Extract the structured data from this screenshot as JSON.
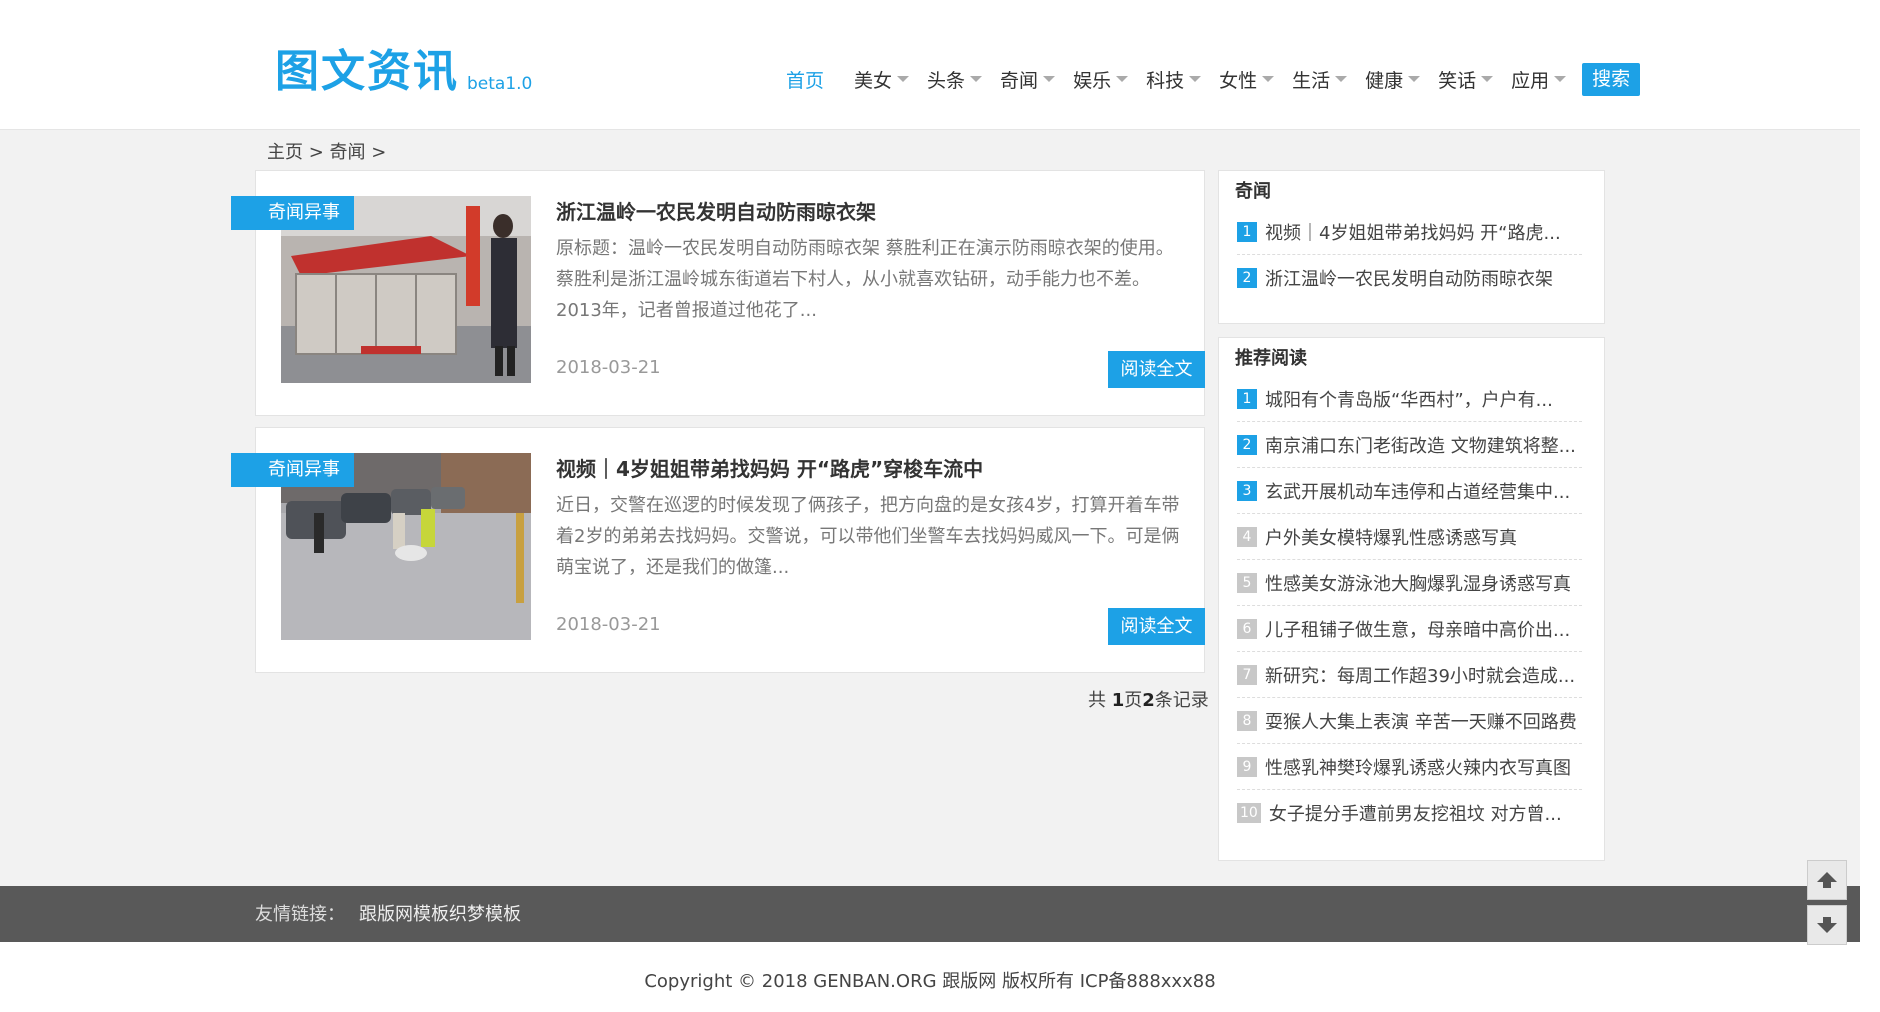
{
  "header": {
    "logo_text": "图文资讯",
    "logo_beta": "beta1.0",
    "nav": [
      {
        "label": "首页",
        "active": true,
        "dropdown": false
      },
      {
        "label": "美女",
        "active": false,
        "dropdown": true
      },
      {
        "label": "头条",
        "active": false,
        "dropdown": true
      },
      {
        "label": "奇闻",
        "active": false,
        "dropdown": true
      },
      {
        "label": "娱乐",
        "active": false,
        "dropdown": true
      },
      {
        "label": "科技",
        "active": false,
        "dropdown": true
      },
      {
        "label": "女性",
        "active": false,
        "dropdown": true
      },
      {
        "label": "生活",
        "active": false,
        "dropdown": true
      },
      {
        "label": "健康",
        "active": false,
        "dropdown": true
      },
      {
        "label": "笑话",
        "active": false,
        "dropdown": true
      },
      {
        "label": "应用",
        "active": false,
        "dropdown": true
      }
    ],
    "search_label": "搜索"
  },
  "breadcrumb": "主页 > 奇闻 >",
  "articles": [
    {
      "tag": "奇闻异事",
      "title": "浙江温岭一农民发明自动防雨晾衣架",
      "desc": "原标题：温岭一农民发明自动防雨晾衣架 蔡胜利正在演示防雨晾衣架的使用。蔡胜利是浙江温岭城东街道岩下村人，从小就喜欢钻研，动手能力也不差。2013年，记者曾报道过他花了...",
      "date": "2018-03-21",
      "read_label": "阅读全文"
    },
    {
      "tag": "奇闻异事",
      "title": "视频｜4岁姐姐带弟找妈妈 开“路虎”穿梭车流中",
      "desc": "近日，交警在巡逻的时候发现了俩孩子，把方向盘的是女孩4岁，打算开着车带着2岁的弟弟去找妈妈。交警说，可以带他们坐警车去找妈妈威风一下。可是俩萌宝说了，还是我们的做篷...",
      "date": "2018-03-21",
      "read_label": "阅读全文"
    }
  ],
  "pagination": {
    "prefix": "共 ",
    "pages": "1",
    "mid": "页",
    "count": "2",
    "suffix": "条记录"
  },
  "sidebar": {
    "box1": {
      "title": "奇闻",
      "items": [
        {
          "num": "1",
          "text": "视频｜4岁姐姐带弟找妈妈 开“路虎..."
        },
        {
          "num": "2",
          "text": "浙江温岭一农民发明自动防雨晾衣架"
        }
      ]
    },
    "box2": {
      "title": "推荐阅读",
      "items": [
        {
          "num": "1",
          "text": "城阳有个青岛版“华西村”，户户有..."
        },
        {
          "num": "2",
          "text": "南京浦口东门老街改造 文物建筑将整..."
        },
        {
          "num": "3",
          "text": "玄武开展机动车违停和占道经营集中..."
        },
        {
          "num": "4",
          "text": "户外美女模特爆乳性感诱惑写真"
        },
        {
          "num": "5",
          "text": "性感美女游泳池大胸爆乳湿身诱惑写真"
        },
        {
          "num": "6",
          "text": "儿子租铺子做生意，母亲暗中高价出..."
        },
        {
          "num": "7",
          "text": "新研究：每周工作超39小时就会造成..."
        },
        {
          "num": "8",
          "text": "耍猴人大集上表演 辛苦一天赚不回路费"
        },
        {
          "num": "9",
          "text": "性感乳神樊玲爆乳诱惑火辣内衣写真图"
        },
        {
          "num": "10",
          "text": "女子提分手遭前男友挖祖坟 对方曾..."
        }
      ]
    }
  },
  "footer": {
    "links_label": "友情链接：",
    "links": [
      "跟版网模板",
      "织梦模板"
    ],
    "copyright": "Copyright © 2018 GENBAN.ORG 跟版网 版权所有 ICP备888xxx88"
  },
  "colors": {
    "accent": "#1da1e6",
    "footer_bg": "#595959"
  }
}
